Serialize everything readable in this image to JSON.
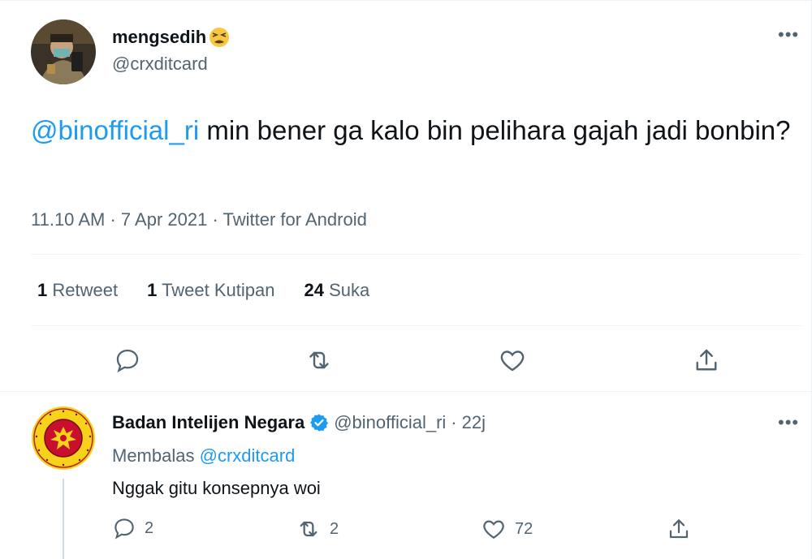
{
  "tweet": {
    "display_name": "mengsedih",
    "display_name_emoji": "tired-face-emoji",
    "handle": "@crxditcard",
    "mention": "@binofficial_ri",
    "text": " min bener ga kalo bin pelihara gajah jadi bonbin?",
    "time": "11.10 AM",
    "date": "7 Apr 2021",
    "source": "Twitter for Android",
    "dot": "·",
    "more": "•••",
    "stats": {
      "retweets_count": "1",
      "retweets_label": "Retweet",
      "quotes_count": "1",
      "quotes_label": "Tweet Kutipan",
      "likes_count": "24",
      "likes_label": "Suka"
    },
    "actions": [
      "reply-icon",
      "retweet-icon",
      "like-icon",
      "share-icon"
    ]
  },
  "reply": {
    "display_name": "Badan Intelijen Negara",
    "verified_icon": "verified-badge-icon",
    "handle": "@binofficial_ri",
    "dot": "·",
    "time_ago": "22j",
    "replying_prefix": "Membalas",
    "replying_to": "@crxditcard",
    "text": "Nggak gitu konsepnya woi",
    "more": "•••",
    "reply_count": "2",
    "retweet_count": "2",
    "like_count": "72"
  },
  "colors": {
    "accent": "#1d9bf0",
    "muted": "#536471",
    "text": "#0f1419",
    "divider": "#eff3f4"
  }
}
